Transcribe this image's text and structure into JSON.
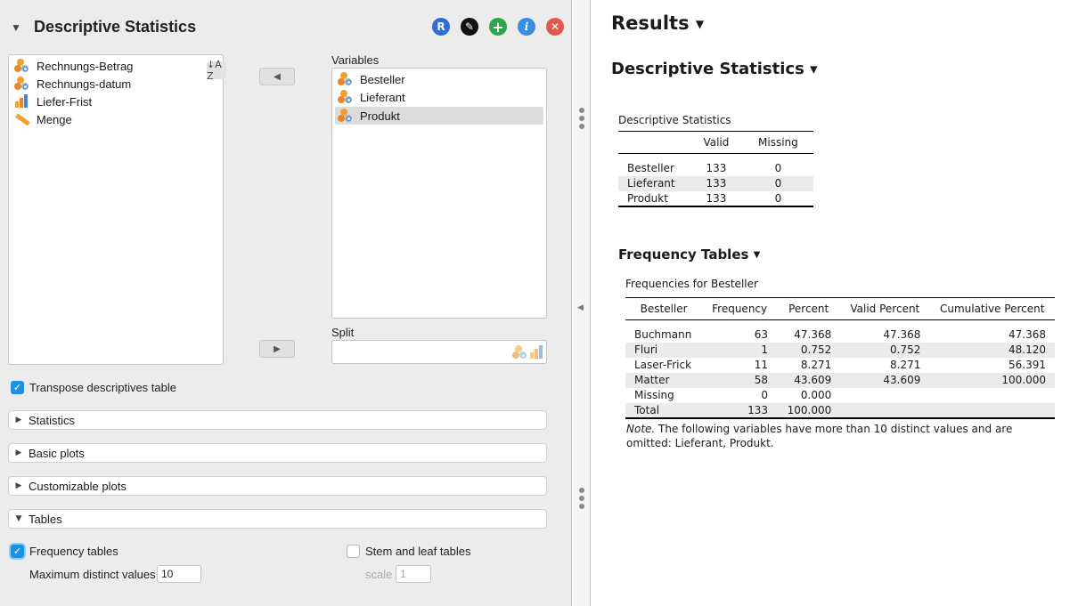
{
  "analysis": {
    "title": "Descriptive Statistics",
    "buttons": [
      {
        "label": "R",
        "color": "#2e6fd1",
        "icon": "r-icon"
      },
      {
        "label": "✎",
        "color": "#111111",
        "icon": "pencil-icon"
      },
      {
        "label": "+",
        "color": "#2ea44f",
        "icon": "plus-icon"
      },
      {
        "label": "i",
        "color": "#3b8de0",
        "icon": "info-icon"
      },
      {
        "label": "✕",
        "color": "#e05a4f",
        "icon": "close-icon"
      }
    ]
  },
  "source_vars": [
    {
      "label": "Rechnungs-Betrag",
      "type": "nominal"
    },
    {
      "label": "Rechnungs-datum",
      "type": "nominal"
    },
    {
      "label": "Liefer-Frist",
      "type": "ordinal"
    },
    {
      "label": "Menge",
      "type": "scale"
    }
  ],
  "sort_label": "↓A Z",
  "variables_box": {
    "label": "Variables",
    "items": [
      {
        "label": "Besteller"
      },
      {
        "label": "Lieferant"
      },
      {
        "label": "Produkt"
      }
    ]
  },
  "split_box": {
    "label": "Split"
  },
  "move_left": "◀",
  "move_right": "▶",
  "transpose": {
    "label": "Transpose descriptives table",
    "checked": true
  },
  "sections": [
    {
      "label": "Statistics",
      "expanded": false
    },
    {
      "label": "Basic plots",
      "expanded": false
    },
    {
      "label": "Customizable plots",
      "expanded": false
    },
    {
      "label": "Tables",
      "expanded": true
    }
  ],
  "tables_options": {
    "frequency_tables": {
      "label": "Frequency tables",
      "checked": true
    },
    "max_distinct": {
      "label": "Maximum distinct values",
      "value": "10"
    },
    "stem_leaf": {
      "label": "Stem and leaf tables",
      "checked": false
    },
    "scale": {
      "label": "scale",
      "value": "1"
    }
  },
  "results": {
    "title": "Results",
    "section_title": "Descriptive Statistics",
    "desc_table": {
      "caption": "Descriptive Statistics",
      "headers": [
        "",
        "Valid",
        "Missing"
      ],
      "rows": [
        [
          "Besteller",
          "133",
          "0"
        ],
        [
          "Lieferant",
          "133",
          "0"
        ],
        [
          "Produkt",
          "133",
          "0"
        ]
      ]
    },
    "freq_title": "Frequency Tables",
    "freq_table": {
      "caption": "Frequencies for Besteller",
      "headers": [
        "Besteller",
        "Frequency",
        "Percent",
        "Valid Percent",
        "Cumulative Percent"
      ],
      "rows": [
        [
          "Buchmann",
          "63",
          "47.368",
          "47.368",
          "47.368"
        ],
        [
          "Fluri",
          "1",
          "0.752",
          "0.752",
          "48.120"
        ],
        [
          "Laser-Frick",
          "11",
          "8.271",
          "8.271",
          "56.391"
        ],
        [
          "Matter",
          "58",
          "43.609",
          "43.609",
          "100.000"
        ],
        [
          "Missing",
          "0",
          "0.000",
          "",
          ""
        ],
        [
          "Total",
          "133",
          "100.000",
          "",
          ""
        ]
      ]
    },
    "note_label": "Note.",
    "note_text": " The following variables have more than 10 distinct values and are omitted: Lieferant, Produkt."
  }
}
